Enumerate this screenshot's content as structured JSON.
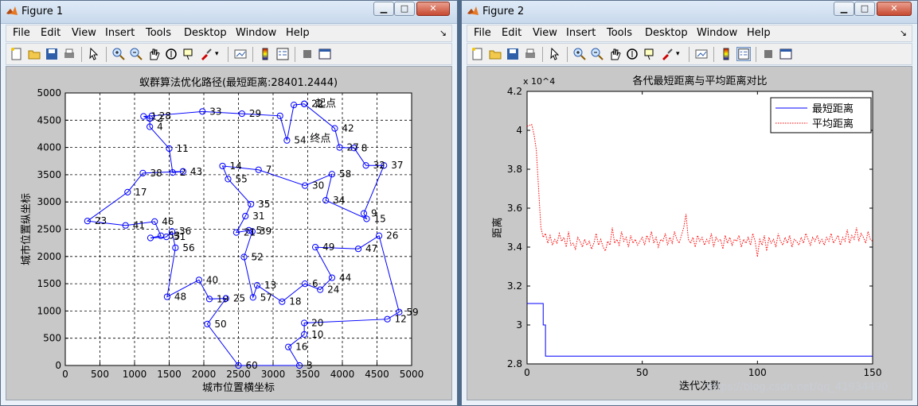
{
  "figure1": {
    "title": "Figure 1",
    "menus": [
      "File",
      "Edit",
      "View",
      "Insert",
      "Tools",
      "Desktop",
      "Window",
      "Help"
    ],
    "chart_data": {
      "type": "line",
      "title": "蚁群算法优化路径(最短距离:28401.2444)",
      "xlabel": "城市位置横坐标",
      "ylabel": "城市位置纵坐标",
      "xlim": [
        0,
        5000
      ],
      "ylim": [
        0,
        5000
      ],
      "xticks": [
        "0",
        "500",
        "1000",
        "1500",
        "2000",
        "2500",
        "3000",
        "3500",
        "4000",
        "4500",
        "5000"
      ],
      "yticks": [
        "0",
        "500",
        "1000",
        "1500",
        "2000",
        "2500",
        "3000",
        "3500",
        "4000",
        "4500",
        "5000"
      ],
      "grid": true,
      "start_label": "起点",
      "end_label": "终点",
      "route": [
        {
          "x": 3450,
          "y": 4800,
          "label": "22"
        },
        {
          "x": 3300,
          "y": 4780,
          "label": ""
        },
        {
          "x": 3200,
          "y": 4130,
          "label": "54"
        },
        {
          "x": 3100,
          "y": 4580,
          "label": ""
        },
        {
          "x": 2550,
          "y": 4620,
          "label": "29"
        },
        {
          "x": 1980,
          "y": 4660,
          "label": "33"
        },
        {
          "x": 1250,
          "y": 4580,
          "label": "28"
        },
        {
          "x": 1130,
          "y": 4570,
          "label": "1"
        },
        {
          "x": 1220,
          "y": 4530,
          "label": "2"
        },
        {
          "x": 1220,
          "y": 4380,
          "label": "4"
        },
        {
          "x": 1500,
          "y": 3980,
          "label": "11"
        },
        {
          "x": 1550,
          "y": 3540,
          "label": "2"
        },
        {
          "x": 1700,
          "y": 3560,
          "label": "43"
        },
        {
          "x": 1120,
          "y": 3530,
          "label": "38"
        },
        {
          "x": 900,
          "y": 3180,
          "label": "17"
        },
        {
          "x": 320,
          "y": 2650,
          "label": "23"
        },
        {
          "x": 870,
          "y": 2570,
          "label": "41"
        },
        {
          "x": 1290,
          "y": 2640,
          "label": "46"
        },
        {
          "x": 1380,
          "y": 2380,
          "label": "53"
        },
        {
          "x": 1230,
          "y": 2340,
          "label": ""
        },
        {
          "x": 1460,
          "y": 2360,
          "label": "51"
        },
        {
          "x": 1540,
          "y": 2460,
          "label": "36"
        },
        {
          "x": 1590,
          "y": 2160,
          "label": "56"
        },
        {
          "x": 1470,
          "y": 1260,
          "label": "48"
        },
        {
          "x": 1930,
          "y": 1570,
          "label": "40"
        },
        {
          "x": 2080,
          "y": 1220,
          "label": "19"
        },
        {
          "x": 2320,
          "y": 1230,
          "label": "25"
        },
        {
          "x": 2050,
          "y": 760,
          "label": "50"
        },
        {
          "x": 2500,
          "y": 0,
          "label": "60"
        },
        {
          "x": 3380,
          "y": 0,
          "label": "3"
        },
        {
          "x": 3220,
          "y": 340,
          "label": "16"
        },
        {
          "x": 3450,
          "y": 570,
          "label": "10"
        },
        {
          "x": 3450,
          "y": 780,
          "label": "20"
        },
        {
          "x": 4650,
          "y": 850,
          "label": "12"
        },
        {
          "x": 4820,
          "y": 980,
          "label": "59"
        },
        {
          "x": 4530,
          "y": 2380,
          "label": "26"
        },
        {
          "x": 4230,
          "y": 2140,
          "label": "47"
        },
        {
          "x": 3610,
          "y": 2170,
          "label": "49"
        },
        {
          "x": 3850,
          "y": 1610,
          "label": "44"
        },
        {
          "x": 3680,
          "y": 1390,
          "label": "24"
        },
        {
          "x": 3460,
          "y": 1500,
          "label": "6"
        },
        {
          "x": 3130,
          "y": 1170,
          "label": "18"
        },
        {
          "x": 2770,
          "y": 1470,
          "label": "13"
        },
        {
          "x": 2710,
          "y": 1250,
          "label": "57"
        },
        {
          "x": 2580,
          "y": 1990,
          "label": "52"
        },
        {
          "x": 2700,
          "y": 2460,
          "label": "39"
        },
        {
          "x": 2650,
          "y": 2480,
          "label": "5"
        },
        {
          "x": 2470,
          "y": 2440,
          "label": "21"
        },
        {
          "x": 2600,
          "y": 2740,
          "label": "31"
        },
        {
          "x": 2680,
          "y": 2960,
          "label": "35"
        },
        {
          "x": 2350,
          "y": 3420,
          "label": "55"
        },
        {
          "x": 2270,
          "y": 3660,
          "label": "14"
        },
        {
          "x": 2790,
          "y": 3590,
          "label": "7"
        },
        {
          "x": 3460,
          "y": 3300,
          "label": "30"
        },
        {
          "x": 3850,
          "y": 3510,
          "label": "58"
        },
        {
          "x": 3760,
          "y": 3030,
          "label": "34"
        },
        {
          "x": 4350,
          "y": 2690,
          "label": "15"
        },
        {
          "x": 4310,
          "y": 2790,
          "label": "9"
        },
        {
          "x": 4600,
          "y": 3670,
          "label": "37"
        },
        {
          "x": 4340,
          "y": 3670,
          "label": "32"
        },
        {
          "x": 4170,
          "y": 3990,
          "label": "8"
        },
        {
          "x": 3960,
          "y": 4000,
          "label": "27"
        },
        {
          "x": 3890,
          "y": 4350,
          "label": "42"
        },
        {
          "x": 3450,
          "y": 4800,
          "label": ""
        }
      ]
    }
  },
  "figure2": {
    "title": "Figure 2",
    "menus": [
      "File",
      "Edit",
      "View",
      "Insert",
      "Tools",
      "Desktop",
      "Window",
      "Help"
    ],
    "chart_data": {
      "type": "line",
      "title": "各代最短距离与平均距离对比",
      "xlabel": "迭代次数",
      "ylabel": "距离",
      "exponent": "x 10^4",
      "xlim": [
        0,
        150
      ],
      "ylim": [
        2.8,
        4.2
      ],
      "xticks": [
        "0",
        "50",
        "100",
        "150"
      ],
      "yticks": [
        "2.8",
        "3",
        "3.2",
        "3.4",
        "3.6",
        "3.8",
        "4",
        "4.2"
      ],
      "grid": false,
      "legend_position": "top-right",
      "series": [
        {
          "name": "最短距离",
          "color": "#0000ff",
          "style": "solid",
          "x": [
            0,
            7,
            7,
            8,
            8,
            150
          ],
          "y": [
            3.11,
            3.11,
            3.0,
            3.0,
            2.84,
            2.84
          ]
        },
        {
          "name": "平均距离",
          "color": "#ff0000",
          "style": "dotted",
          "x": [
            0,
            2,
            3,
            4,
            5,
            6,
            7,
            8,
            9,
            10,
            11,
            12,
            13,
            14,
            15,
            16,
            17,
            18,
            19,
            20,
            21,
            22,
            23,
            24,
            25,
            26,
            27,
            28,
            29,
            30,
            31,
            32,
            33,
            34,
            35,
            36,
            37,
            38,
            39,
            40,
            41,
            42,
            43,
            44,
            45,
            46,
            47,
            48,
            49,
            50,
            51,
            52,
            53,
            54,
            55,
            56,
            57,
            58,
            59,
            60,
            61,
            62,
            63,
            64,
            65,
            66,
            67,
            68,
            69,
            70,
            71,
            72,
            73,
            74,
            75,
            76,
            77,
            78,
            79,
            80,
            81,
            82,
            83,
            84,
            85,
            86,
            87,
            88,
            89,
            90,
            91,
            92,
            93,
            94,
            95,
            96,
            97,
            98,
            99,
            100,
            101,
            102,
            103,
            104,
            105,
            106,
            107,
            108,
            109,
            110,
            111,
            112,
            113,
            114,
            115,
            116,
            117,
            118,
            119,
            120,
            121,
            122,
            123,
            124,
            125,
            126,
            127,
            128,
            129,
            130,
            131,
            132,
            133,
            134,
            135,
            136,
            137,
            138,
            139,
            140,
            141,
            142,
            143,
            144,
            145,
            146,
            147,
            148,
            149,
            150
          ],
          "y": [
            4.02,
            4.03,
            3.98,
            3.9,
            3.7,
            3.5,
            3.45,
            3.47,
            3.42,
            3.46,
            3.41,
            3.44,
            3.42,
            3.47,
            3.43,
            3.45,
            3.4,
            3.48,
            3.41,
            3.42,
            3.39,
            3.45,
            3.43,
            3.4,
            3.44,
            3.41,
            3.43,
            3.39,
            3.42,
            3.47,
            3.41,
            3.44,
            3.4,
            3.38,
            3.43,
            3.41,
            3.5,
            3.42,
            3.44,
            3.41,
            3.48,
            3.43,
            3.45,
            3.4,
            3.46,
            3.42,
            3.44,
            3.41,
            3.43,
            3.45,
            3.41,
            3.46,
            3.43,
            3.48,
            3.42,
            3.45,
            3.4,
            3.44,
            3.43,
            3.47,
            3.41,
            3.45,
            3.42,
            3.48,
            3.44,
            3.42,
            3.46,
            3.5,
            3.57,
            3.44,
            3.42,
            3.45,
            3.4,
            3.46,
            3.43,
            3.45,
            3.41,
            3.44,
            3.42,
            3.47,
            3.4,
            3.45,
            3.43,
            3.44,
            3.39,
            3.46,
            3.42,
            3.45,
            3.41,
            3.44,
            3.43,
            3.46,
            3.4,
            3.44,
            3.42,
            3.45,
            3.41,
            3.47,
            3.43,
            3.35,
            3.44,
            3.41,
            3.46,
            3.38,
            3.45,
            3.42,
            3.44,
            3.4,
            3.47,
            3.43,
            3.41,
            3.45,
            3.42,
            3.46,
            3.4,
            3.44,
            3.43,
            3.41,
            3.45,
            3.42,
            3.47,
            3.44,
            3.41,
            3.45,
            3.43,
            3.46,
            3.42,
            3.44,
            3.41,
            3.45,
            3.43,
            3.47,
            3.42,
            3.44,
            3.46,
            3.41,
            3.45,
            3.43,
            3.49,
            3.42,
            3.46,
            3.44,
            3.5,
            3.43,
            3.47,
            3.45,
            3.42,
            3.48,
            3.44,
            3.43
          ]
        }
      ]
    }
  },
  "watermark": "https://blog.csdn.net/qq_41934490",
  "colors": {
    "blue": "#0000ff",
    "red": "#ff0000",
    "axisbg": "#ffffff",
    "figbg": "#c8c8c8"
  }
}
